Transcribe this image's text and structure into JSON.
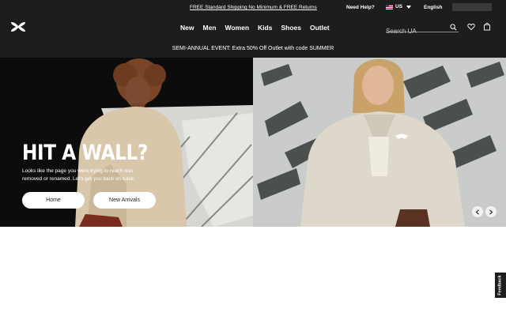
{
  "utility": {
    "promo": "FREE Standard Shipping No Minimum & FREE Returns",
    "help": "Need Help?",
    "country": "US",
    "language": "English"
  },
  "nav": {
    "items": [
      "New",
      "Men",
      "Women",
      "Kids",
      "Shoes",
      "Outlet"
    ],
    "search_placeholder": "Search UA"
  },
  "announcement": "SEMI-ANNUAL EVENT: Extra 50% Off Outlet with code SUMMER",
  "hero": {
    "heading": "HIT A WALL?",
    "subtext": "Looks like the page you were trying to reach was removed or renamed. Let's get you back on track.",
    "buttons": [
      "Home",
      "New Arrivals"
    ]
  },
  "feedback": "Feedback",
  "colors": {
    "header_bg": "#1d1d1d",
    "button_bg": "#ffffff",
    "hero_left_bg": "#0c0c0c",
    "hero_right_bg": "#c8cbc9"
  },
  "icons": [
    "under-armour-logo",
    "us-flag-icon",
    "chevron-down-icon",
    "search-icon",
    "heart-icon",
    "bag-icon",
    "chevron-left-icon",
    "chevron-right-icon"
  ]
}
